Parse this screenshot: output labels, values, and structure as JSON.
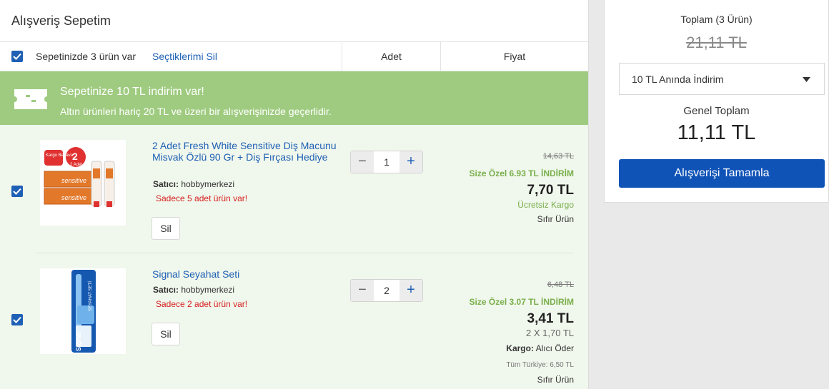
{
  "cart": {
    "title": "Alışveriş Sepetim",
    "count_text": "Sepetinizde 3 ürün var",
    "delete_selected": "Seçtiklerimi Sil",
    "col_qty": "Adet",
    "col_price": "Fiyat"
  },
  "promo": {
    "title": "Sepetinize 10 TL indirim var!",
    "desc": "Altın ürünleri hariç 20 TL ve üzeri bir alışverişinizde geçerlidir."
  },
  "items": [
    {
      "name": "2 Adet Fresh White Sensitive Diş Macunu Misvak Özlü 90 Gr + Diş Fırçası Hediye",
      "seller_label": "Satıcı:",
      "seller": "hobbymerkezi",
      "stock": "Sadece 5 adet ürün var!",
      "delete": "Sil",
      "qty": "1",
      "old_price": "14,63 TL",
      "discount": "Size Özel 6.93 TL İNDİRİM",
      "price": "7,70 TL",
      "cargo": "Ücretsiz Kargo",
      "zero": "Sıfır Ürün",
      "image_text": [
        "Kargo Bedava",
        "2 Adet",
        "sensitive"
      ]
    },
    {
      "name": "Signal Seyahat Seti",
      "seller_label": "Satıcı:",
      "seller": "hobbymerkezi",
      "stock": "Sadece 2 adet ürün var!",
      "delete": "Sil",
      "qty": "2",
      "old_price": "6,48 TL",
      "discount": "Size Özel 3.07 TL İNDİRİM",
      "price": "3,41 TL",
      "unit": "2 X 1,70 TL",
      "cargo_label": "Kargo:",
      "cargo": "Alıcı Öder",
      "all_turkey": "Tüm Türkiye: 6,50 TL",
      "zero": "Sıfır Ürün",
      "image_text": [
        "Signal",
        "SEYAHAT SETİ"
      ]
    }
  ],
  "summary": {
    "total_label": "Toplam (3 Ürün)",
    "total_old": "21,11 TL",
    "discount_option": "10 TL Anında İndirim",
    "grand_label": "Genel Toplam",
    "grand_value": "11,11 TL",
    "complete": "Alışverişi Tamamla"
  },
  "colors": {
    "accent": "#1e60b5",
    "promo_bg": "#9fcb80",
    "item_bg": "#f0f7ec",
    "discount_green": "#7aaf4c",
    "stock_red": "#d62020",
    "button_blue": "#0f53b7"
  },
  "icons": {
    "checkbox": "check-icon",
    "promo": "ticket-icon",
    "dropdown": "chevron-down-icon",
    "minus": "minus-icon",
    "plus": "plus-icon"
  }
}
